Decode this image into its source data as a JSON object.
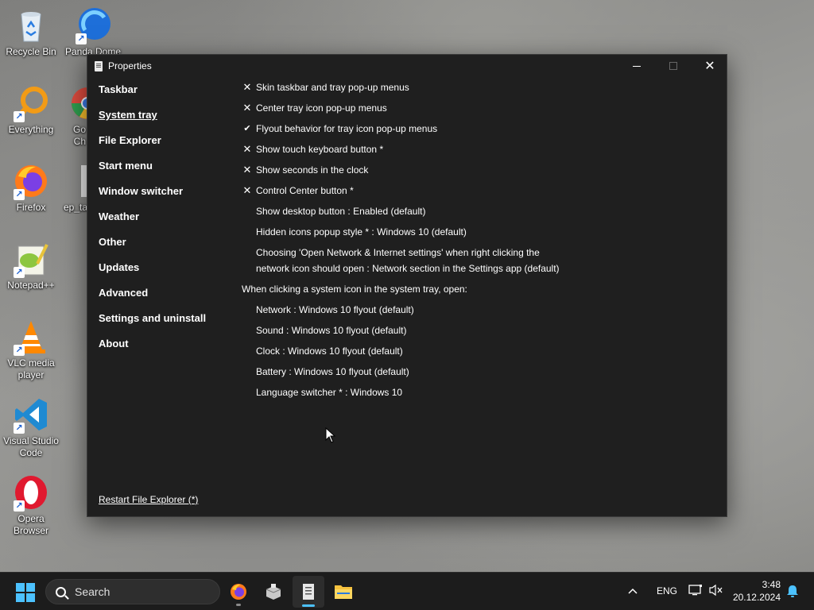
{
  "desktop": {
    "icons": [
      {
        "label": "Recycle Bin",
        "icon": "recycle-bin-icon"
      },
      {
        "label": "Panda Dome",
        "icon": "panda-dome-icon"
      },
      {
        "label": "Everything",
        "icon": "everything-search-icon"
      },
      {
        "label": "Go\nCh",
        "icon": "google-chrome-icon"
      },
      {
        "label": "Firefox",
        "icon": "firefox-icon"
      },
      {
        "label": "ep_ta",
        "icon": "ep-taskbar-icon"
      },
      {
        "label": "Notepad++",
        "icon": "notepadpp-icon"
      },
      {
        "label": "VLC media player",
        "icon": "vlc-icon"
      },
      {
        "label": "Visual Studio Code",
        "icon": "vscode-icon"
      },
      {
        "label": "Opera Browser",
        "icon": "opera-icon"
      }
    ]
  },
  "window": {
    "title": "Properties",
    "controls": {
      "minimize": "—",
      "maximize": "☐",
      "close": "✕"
    }
  },
  "sidebar": {
    "items": [
      {
        "label": "Taskbar"
      },
      {
        "label": "System tray"
      },
      {
        "label": "File Explorer"
      },
      {
        "label": "Start menu"
      },
      {
        "label": "Window switcher"
      },
      {
        "label": "Weather"
      },
      {
        "label": "Other"
      },
      {
        "label": "Updates"
      },
      {
        "label": "Advanced"
      },
      {
        "label": "Settings and uninstall"
      },
      {
        "label": "About"
      }
    ],
    "active_index": 1,
    "restart_link": "Restart File Explorer (*)"
  },
  "settings": {
    "rows": [
      {
        "mark": "✕",
        "text": "Skin taskbar and tray pop-up menus"
      },
      {
        "mark": "✕",
        "text": "Center tray icon pop-up menus"
      },
      {
        "mark": "✔",
        "text": "Flyout behavior for tray icon pop-up menus"
      },
      {
        "mark": "✕",
        "text": "Show touch keyboard button *"
      },
      {
        "mark": "✕",
        "text": "Show seconds in the clock"
      },
      {
        "mark": "✕",
        "text": "Control Center button *"
      },
      {
        "mark": "",
        "text": "Show desktop button : Enabled (default)"
      },
      {
        "mark": "",
        "text": "Hidden icons popup style * : Windows 10 (default)"
      },
      {
        "mark": "",
        "text": "Choosing 'Open Network & Internet settings' when right clicking the network icon should open : Network section in the Settings app (default)"
      },
      {
        "mark": "",
        "text": "When clicking a system icon in the system tray, open:"
      },
      {
        "mark": "",
        "text": "Network : Windows 10 flyout (default)"
      },
      {
        "mark": "",
        "text": "Sound : Windows 10 flyout (default)"
      },
      {
        "mark": "",
        "text": "Clock : Windows 10 flyout (default)"
      },
      {
        "mark": "",
        "text": "Battery : Windows 10 flyout (default)"
      },
      {
        "mark": "",
        "text": "Language switcher * : Windows 10"
      }
    ]
  },
  "taskbar": {
    "search_placeholder": "Search",
    "apps": [
      "firefox-icon",
      "package-icon",
      "properties-app-icon",
      "file-explorer-icon"
    ],
    "tray": {
      "chevron": "^",
      "language": "ENG",
      "time": "3:48",
      "date": "20.12.2024"
    }
  },
  "colors": {
    "accent": "#4cc2ff",
    "window_bg": "#1f1f1f",
    "taskbar_bg": "#1c1c1c"
  }
}
